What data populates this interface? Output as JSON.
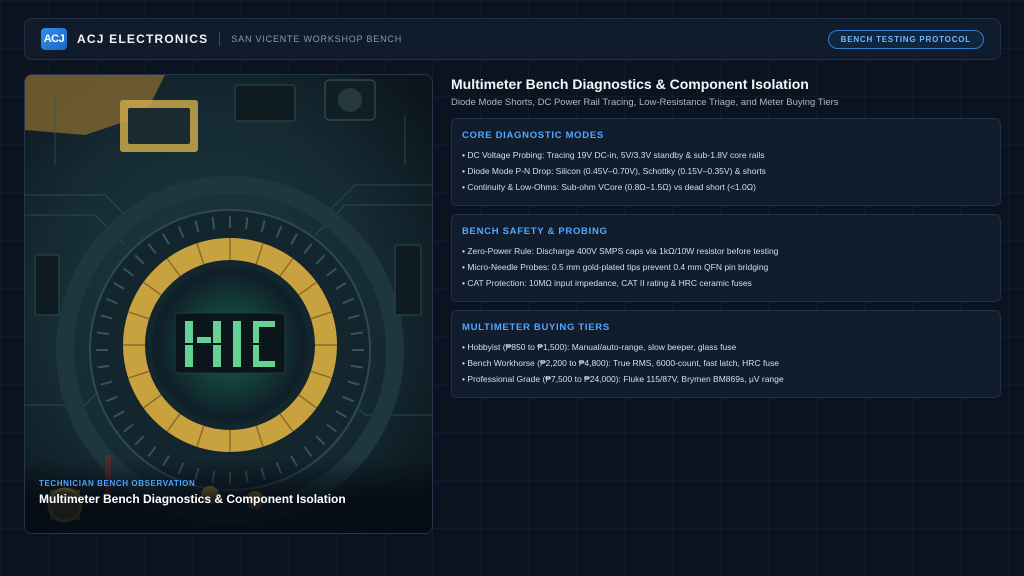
{
  "header": {
    "logo_text": "ACJ",
    "brand": "ACJ ELECTRONICS",
    "location": "SAN VICENTE WORKSHOP BENCH",
    "badge": "BENCH TESTING PROTOCOL"
  },
  "image_card": {
    "eyebrow": "TECHNICIAN BENCH OBSERVATION",
    "title": "Multimeter Bench Diagnostics & Component Isolation"
  },
  "main": {
    "title": "Multimeter Bench Diagnostics & Component Isolation",
    "subtitle": "Diode Mode Shorts, DC Power Rail Tracing, Low-Resistance Triage, and Meter Buying Tiers"
  },
  "sections": [
    {
      "title": "CORE DIAGNOSTIC MODES",
      "items": [
        "DC Voltage Probing: Tracing 19V DC-in, 5V/3.3V standby & sub-1.8V core rails",
        "Diode Mode P-N Drop: Silicon (0.45V–0.70V), Schottky (0.15V–0.35V) & shorts",
        "Continuity & Low-Ohms: Sub-ohm VCore (0.8Ω–1.5Ω) vs dead short (<1.0Ω)"
      ]
    },
    {
      "title": "BENCH SAFETY & PROBING",
      "items": [
        "Zero-Power Rule: Discharge 400V SMPS caps via 1kΩ/10W resistor before testing",
        "Micro-Needle Probes: 0.5 mm gold-plated tips prevent 0.4 mm QFN pin bridging",
        "CAT Protection: 10MΩ input impedance, CAT II rating & HRC ceramic fuses"
      ]
    },
    {
      "title": "MULTIMETER BUYING TIERS",
      "items": [
        "Hobbyist (₱850 to ₱1,500): Manual/auto-range, slow beeper, glass fuse",
        "Bench Workhorse (₱2,200 to ₱4,800): True RMS, 6000-count, fast latch, HRC fuse",
        "Professional Grade (₱7,500 to ₱24,000): Fluke 115/87V, Brymen BM869s, μV range"
      ]
    }
  ]
}
